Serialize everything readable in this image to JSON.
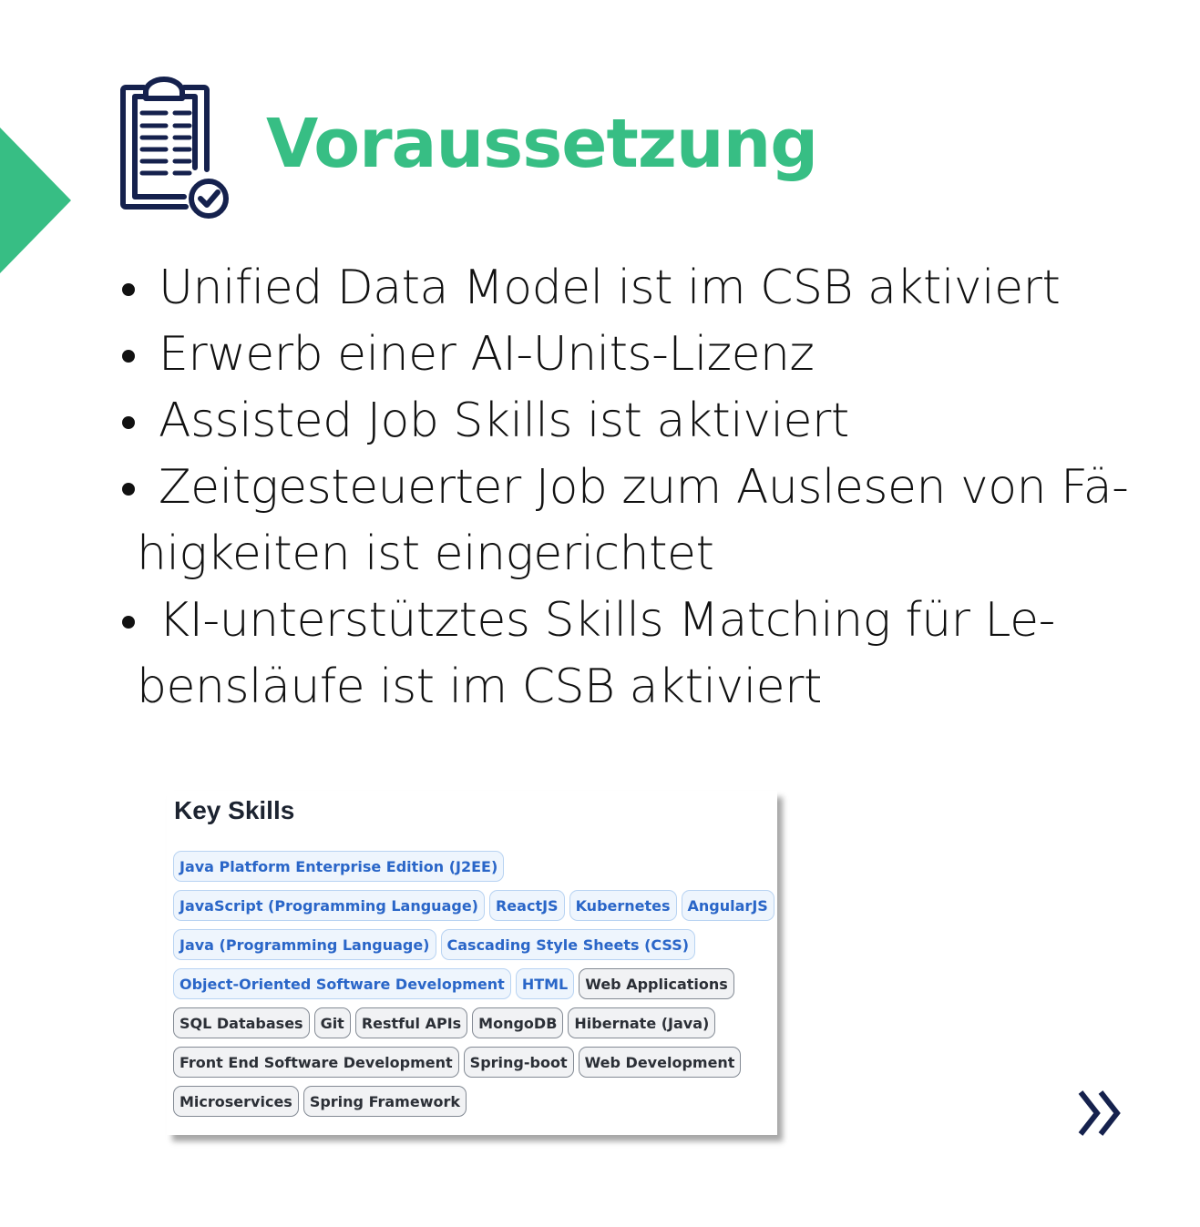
{
  "header": {
    "title": "Voraussetzung",
    "icon": "clipboard-check-icon",
    "accent_color": "#37be84",
    "icon_color": "#15214d"
  },
  "requirements": [
    {
      "line1": "Unified Data Model ist im CSB aktiviert",
      "line2": ""
    },
    {
      "line1": "Erwerb einer AI-Units-Lizenz",
      "line2": ""
    },
    {
      "line1": "Assisted Job Skills ist aktiviert",
      "line2": ""
    },
    {
      "line1": "Zeitgesteuerter Job zum Auslesen von Fä-",
      "line2": "higkeiten ist eingerichtet"
    },
    {
      "line1": "KI-unterstütztes Skills Matching für Le-",
      "line2": "bensläufe ist im CSB aktiviert"
    }
  ],
  "key_skills": {
    "title": "Key Skills",
    "rows": [
      [
        {
          "label": "Java Platform Enterprise Edition (J2EE)",
          "style": "blue"
        }
      ],
      [
        {
          "label": "JavaScript (Programming Language)",
          "style": "blue"
        },
        {
          "label": "ReactJS",
          "style": "blue"
        },
        {
          "label": "Kubernetes",
          "style": "blue"
        },
        {
          "label": "AngularJS",
          "style": "blue"
        }
      ],
      [
        {
          "label": "Java (Programming Language)",
          "style": "blue"
        },
        {
          "label": "Cascading Style Sheets (CSS)",
          "style": "blue"
        }
      ],
      [
        {
          "label": "Object-Oriented Software Development",
          "style": "blue"
        },
        {
          "label": "HTML",
          "style": "blue"
        },
        {
          "label": "Web Applications",
          "style": "gray"
        }
      ],
      [
        {
          "label": "SQL Databases",
          "style": "gray"
        },
        {
          "label": "Git",
          "style": "gray"
        },
        {
          "label": "Restful APIs",
          "style": "gray"
        },
        {
          "label": "MongoDB",
          "style": "gray"
        },
        {
          "label": "Hibernate (Java)",
          "style": "gray"
        }
      ],
      [
        {
          "label": "Front End Software Development",
          "style": "gray"
        },
        {
          "label": "Spring-boot",
          "style": "gray"
        },
        {
          "label": "Web Development",
          "style": "gray"
        }
      ],
      [
        {
          "label": "Microservices",
          "style": "gray"
        },
        {
          "label": "Spring Framework",
          "style": "gray"
        }
      ]
    ]
  },
  "navigation": {
    "next_icon": "double-chevron-right-icon"
  }
}
